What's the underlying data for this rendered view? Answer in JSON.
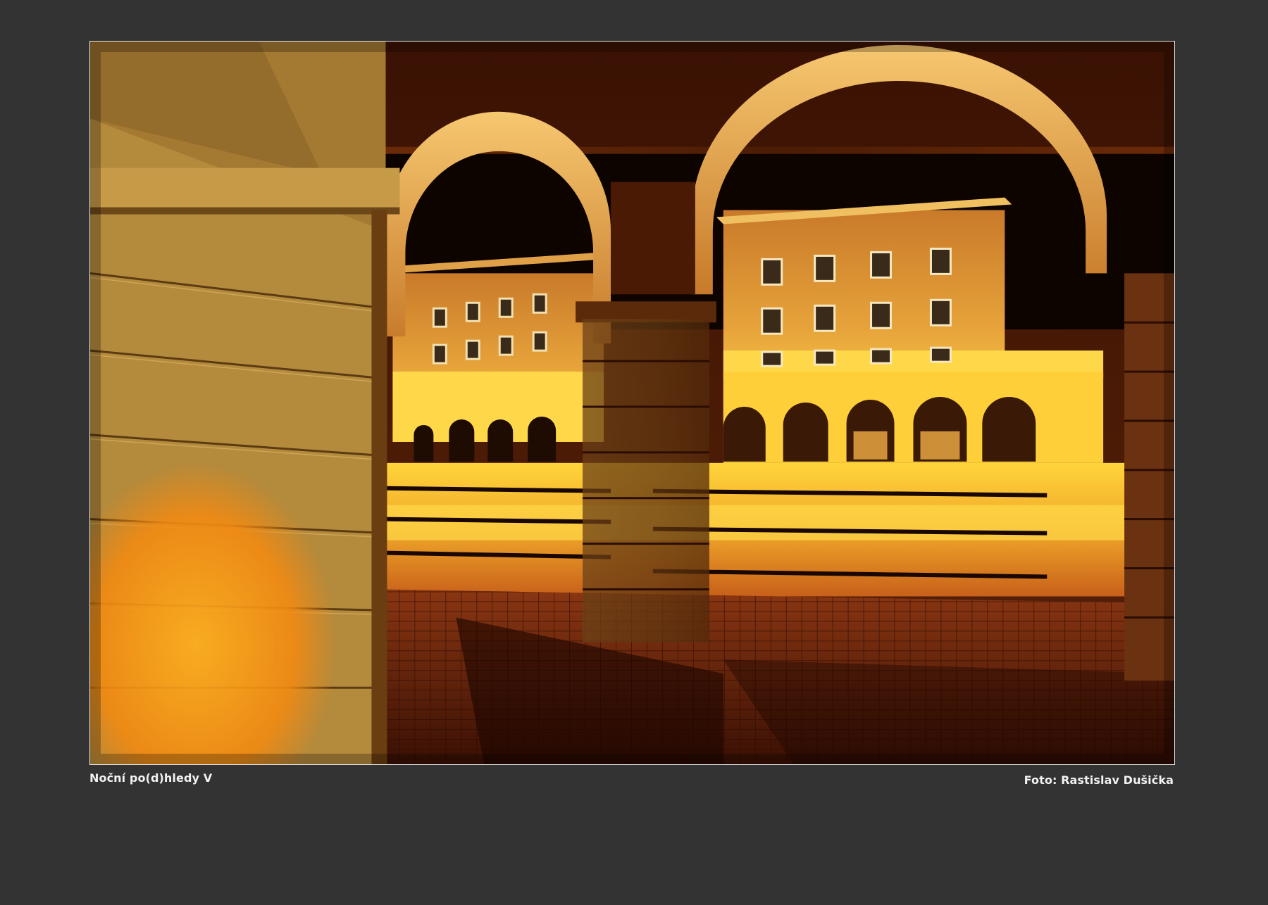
{
  "photo": {
    "title": "Noční po(d)hledy V",
    "credit": "Foto: Rastislav Dušička",
    "palette": {
      "background": "#333333",
      "frame_border": "#e6e6e6",
      "lamp_glow": "#ffd23a",
      "shadow": "#1a0800"
    }
  }
}
